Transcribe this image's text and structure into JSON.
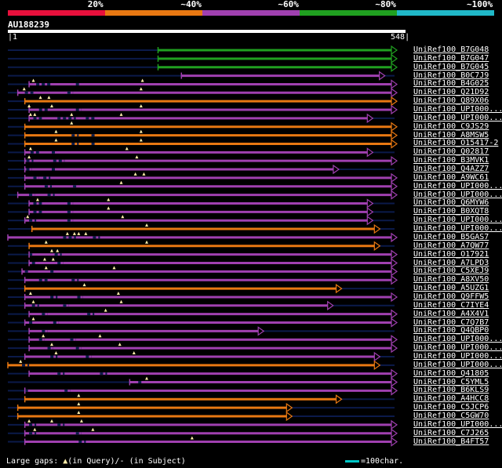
{
  "scale": {
    "labels": [
      "20%",
      "~40%",
      "~60%",
      "~80%",
      "~100%"
    ],
    "colors": [
      "#e8103c",
      "#e87812",
      "#a040b0",
      "#20a020",
      "#20b8c8"
    ]
  },
  "query": {
    "id": "AU188239",
    "start": "1",
    "end": "548",
    "length": 548
  },
  "colors": {
    "background": "#000000",
    "unaligned": "#0b1a4a",
    "purple": "#a040b0",
    "orange": "#e87812",
    "green": "#20a020",
    "gap_marker": "#ffeeaa"
  },
  "hits": [
    {
      "id": "UniRef100_B7G048",
      "start": 212,
      "end": 548,
      "color": "green",
      "gaps": [],
      "tri": []
    },
    {
      "id": "UniRef100_B7G047",
      "start": 212,
      "end": 548,
      "color": "green",
      "gaps": [],
      "tri": []
    },
    {
      "id": "UniRef100_B7G045",
      "start": 212,
      "end": 548,
      "color": "green",
      "gaps": [],
      "tri": []
    },
    {
      "id": "UniRef100_B0C7J9",
      "start": 245,
      "end": 531,
      "color": "purple",
      "gaps": [],
      "tri": []
    },
    {
      "id": "UniRef100_B4G025",
      "start": 30,
      "end": 548,
      "color": "purple",
      "gaps": [
        [
          40,
          62
        ],
        [
          96,
          102
        ]
      ],
      "tri": [
        36,
        190
      ]
    },
    {
      "id": "UniRef100_Q21D92",
      "start": 14,
      "end": 548,
      "color": "purple",
      "gaps": [
        [
          24,
          36
        ],
        [
          84,
          92
        ]
      ],
      "tri": [
        23,
        188
      ]
    },
    {
      "id": "UniRef100_Q89X06",
      "start": 24,
      "end": 548,
      "color": "orange",
      "gaps": [],
      "tri": [
        46,
        58
      ]
    },
    {
      "id": "UniRef100_UPI000...a",
      "start": 30,
      "end": 548,
      "color": "purple",
      "gaps": [
        [
          44,
          58
        ],
        [
          96,
          104
        ]
      ],
      "tri": [
        30,
        62,
        188
      ]
    },
    {
      "id": "UniRef100_UPI000...b",
      "start": 30,
      "end": 514,
      "color": "purple",
      "gaps": [
        [
          36,
          48
        ],
        [
          70,
          96
        ],
        [
          110,
          124
        ]
      ],
      "tri": [
        32,
        38,
        90,
        160
      ]
    },
    {
      "id": "UniRef100_C9JS29",
      "start": 24,
      "end": 548,
      "color": "orange",
      "gaps": [],
      "tri": [
        90
      ]
    },
    {
      "id": "UniRef100_A8MSW5",
      "start": 24,
      "end": 548,
      "color": "orange",
      "gaps": [
        [
          90,
          100
        ],
        [
          118,
          124
        ]
      ],
      "tri": [
        68,
        188
      ]
    },
    {
      "id": "UniRef100_O15417-2",
      "start": 24,
      "end": 548,
      "color": "orange",
      "gaps": [
        [
          90,
          100
        ],
        [
          118,
          124
        ]
      ],
      "tri": [
        68,
        188
      ]
    },
    {
      "id": "UniRef100_Q02817",
      "start": 24,
      "end": 514,
      "color": "purple",
      "gaps": [
        [
          32,
          44
        ],
        [
          62,
          68
        ]
      ],
      "tri": [
        32,
        168
      ]
    },
    {
      "id": "UniRef100_B3MVK1",
      "start": 24,
      "end": 548,
      "color": "purple",
      "gaps": [
        [
          26,
          36
        ],
        [
          64,
          80
        ]
      ],
      "tri": [
        30,
        182
      ]
    },
    {
      "id": "UniRef100_Q4AZZ7",
      "start": 24,
      "end": 466,
      "color": "purple",
      "gaps": [
        [
          26,
          34
        ],
        [
          62,
          68
        ]
      ],
      "tri": []
    },
    {
      "id": "UniRef100_A9WC61",
      "start": 24,
      "end": 548,
      "color": "purple",
      "gaps": [
        [
          36,
          44
        ],
        [
          50,
          60
        ]
      ],
      "tri": [
        180,
        192
      ]
    },
    {
      "id": "UniRef100_UPI000...c",
      "start": 24,
      "end": 548,
      "color": "purple",
      "gaps": [
        [
          52,
          62
        ],
        [
          92,
          98
        ]
      ],
      "tri": [
        160
      ]
    },
    {
      "id": "UniRef100_UPI000...d",
      "start": 14,
      "end": 548,
      "color": "purple",
      "gaps": [
        [
          30,
          38
        ],
        [
          56,
          66
        ]
      ],
      "tri": []
    },
    {
      "id": "UniRef100_Q6MYW6",
      "start": 30,
      "end": 514,
      "color": "purple",
      "gaps": [
        [
          36,
          48
        ],
        [
          84,
          92
        ]
      ],
      "tri": [
        42,
        142
      ]
    },
    {
      "id": "UniRef100_B0XQT8",
      "start": 30,
      "end": 514,
      "color": "purple",
      "gaps": [
        [
          36,
          48
        ],
        [
          84,
          92
        ]
      ],
      "tri": [
        142
      ]
    },
    {
      "id": "UniRef100_UPI000...e",
      "start": 24,
      "end": 514,
      "color": "purple",
      "gaps": [
        [
          30,
          40
        ],
        [
          84,
          92
        ]
      ],
      "tri": [
        28,
        162
      ]
    },
    {
      "id": "UniRef100_UPI000...f",
      "start": 34,
      "end": 524,
      "color": "orange",
      "gaps": [],
      "tri": [
        196
      ]
    },
    {
      "id": "UniRef100_B5GAS7",
      "start": 0,
      "end": 548,
      "color": "purple",
      "gaps": [
        [
          78,
          96
        ],
        [
          120,
          130
        ]
      ],
      "tri": [
        84,
        94,
        100,
        110
      ]
    },
    {
      "id": "UniRef100_A7QW77",
      "start": 30,
      "end": 524,
      "color": "orange",
      "gaps": [],
      "tri": [
        54,
        196
      ]
    },
    {
      "id": "UniRef100_O17921",
      "start": 30,
      "end": 548,
      "color": "purple",
      "gaps": [
        [
          30,
          36
        ],
        [
          66,
          76
        ]
      ],
      "tri": [
        62,
        70
      ]
    },
    {
      "id": "UniRef100_A7LPD3",
      "start": 30,
      "end": 548,
      "color": "purple",
      "gaps": [
        [
          34,
          40
        ],
        [
          70,
          78
        ]
      ],
      "tri": [
        52,
        64
      ]
    },
    {
      "id": "UniRef100_C5XEJ9",
      "start": 20,
      "end": 548,
      "color": "purple",
      "gaps": [
        [
          24,
          30
        ],
        [
          60,
          66
        ]
      ],
      "tri": [
        54,
        150
      ]
    },
    {
      "id": "UniRef100_A8XV50",
      "start": 24,
      "end": 548,
      "color": "purple",
      "gaps": [
        [
          44,
          56
        ],
        [
          90,
          100
        ]
      ],
      "tri": []
    },
    {
      "id": "UniRef100_A5UZG1",
      "start": 24,
      "end": 470,
      "color": "orange",
      "gaps": [],
      "tri": [
        108
      ]
    },
    {
      "id": "UniRef100_Q9FFW5",
      "start": 24,
      "end": 548,
      "color": "purple",
      "gaps": [
        [
          60,
          70
        ],
        [
          98,
          106
        ]
      ],
      "tri": [
        32,
        156
      ]
    },
    {
      "id": "UniRef100_C7IYE4",
      "start": 24,
      "end": 458,
      "color": "purple",
      "gaps": [
        [
          34,
          44
        ],
        [
          78,
          86
        ]
      ],
      "tri": [
        36,
        160
      ]
    },
    {
      "id": "UniRef100_A4X4V1",
      "start": 30,
      "end": 548,
      "color": "purple",
      "gaps": [
        [
          48,
          56
        ],
        [
          112,
          122
        ]
      ],
      "tri": [
        138
      ]
    },
    {
      "id": "UniRef100_C7Q7B7",
      "start": 24,
      "end": 548,
      "color": "purple",
      "gaps": [
        [
          30,
          36
        ],
        [
          64,
          72
        ]
      ],
      "tri": [
        36
      ]
    },
    {
      "id": "UniRef100_Q4QBP0",
      "start": 30,
      "end": 360,
      "color": "purple",
      "gaps": [
        [
          48,
          56
        ]
      ],
      "tri": []
    },
    {
      "id": "UniRef100_UPI000...g",
      "start": 30,
      "end": 548,
      "color": "purple",
      "gaps": [
        [
          44,
          52
        ],
        [
          88,
          96
        ]
      ],
      "tri": [
        50,
        130
      ]
    },
    {
      "id": "UniRef100_UPI000...h",
      "start": 30,
      "end": 548,
      "color": "purple",
      "gaps": [
        [
          56,
          64
        ],
        [
          96,
          104
        ]
      ],
      "tri": [
        62,
        158
      ]
    },
    {
      "id": "UniRef100_UPI000...i",
      "start": 24,
      "end": 524,
      "color": "purple",
      "gaps": [
        [
          60,
          70
        ],
        [
          110,
          118
        ]
      ],
      "tri": [
        68,
        178
      ]
    },
    {
      "id": "UniRef100_UPI000...j",
      "start": 0,
      "end": 524,
      "color": "orange",
      "gaps": [
        [
          20,
          30
        ]
      ],
      "tri": [
        18
      ]
    },
    {
      "id": "UniRef100_Q41805",
      "start": 30,
      "end": 548,
      "color": "purple",
      "gaps": [
        [
          70,
          80
        ],
        [
          130,
          140
        ]
      ],
      "tri": []
    },
    {
      "id": "UniRef100_C5YML5",
      "start": 172,
      "end": 548,
      "color": "purple",
      "gaps": [
        [
          184,
          190
        ]
      ],
      "tri": [
        196
      ]
    },
    {
      "id": "UniRef100_B6KLS9",
      "start": 24,
      "end": 548,
      "color": "purple",
      "gaps": [
        [
          24,
          30
        ],
        [
          80,
          88
        ]
      ],
      "tri": []
    },
    {
      "id": "UniRef100_A4HCC8",
      "start": 24,
      "end": 470,
      "color": "orange",
      "gaps": [],
      "tri": [
        100
      ]
    },
    {
      "id": "UniRef100_C5JCP6",
      "start": 14,
      "end": 400,
      "color": "orange",
      "gaps": [],
      "tri": [
        100
      ]
    },
    {
      "id": "UniRef100_C5GW70",
      "start": 14,
      "end": 400,
      "color": "orange",
      "gaps": [],
      "tri": [
        100
      ]
    },
    {
      "id": "UniRef100_UPI000...k",
      "start": 24,
      "end": 548,
      "color": "purple",
      "gaps": [
        [
          30,
          40
        ],
        [
          70,
          80
        ]
      ],
      "tri": [
        30,
        62,
        104
      ]
    },
    {
      "id": "UniRef100_C7J265",
      "start": 24,
      "end": 548,
      "color": "purple",
      "gaps": [
        [
          30,
          40
        ],
        [
          96,
          104
        ]
      ],
      "tri": [
        38,
        120
      ]
    },
    {
      "id": "UniRef100_B4FT57",
      "start": 24,
      "end": 548,
      "color": "purple",
      "gaps": [
        [
          100,
          110
        ]
      ],
      "tri": [
        260
      ]
    }
  ],
  "hit_display_names": [
    "UniRef100_B7G048",
    "UniRef100_B7G047",
    "UniRef100_B7G045",
    "UniRef100_B0C7J9",
    "UniRef100_B4G025",
    "UniRef100_Q21D92",
    "UniRef100_Q89X06",
    "UniRef100_UPI000...",
    "UniRef100_UPI000...",
    "UniRef100_C9JS29",
    "UniRef100_A8MSW5",
    "UniRef100_O15417-2",
    "UniRef100_Q02817",
    "UniRef100_B3MVK1",
    "UniRef100_Q4AZZ7",
    "UniRef100_A9WC61",
    "UniRef100_UPI000...",
    "UniRef100_UPI000...",
    "UniRef100_Q6MYW6",
    "UniRef100_B0XQT8",
    "UniRef100_UPI000...",
    "UniRef100_UPI000...",
    "UniRef100_B5GAS7",
    "UniRef100_A7QW77",
    "UniRef100_O17921",
    "UniRef100_A7LPD3",
    "UniRef100_C5XEJ9",
    "UniRef100_A8XV50",
    "UniRef100_A5UZG1",
    "UniRef100_Q9FFW5",
    "UniRef100_C7IYE4",
    "UniRef100_A4X4V1",
    "UniRef100_C7Q7B7",
    "UniRef100_Q4QBP0",
    "UniRef100_UPI000...",
    "UniRef100_UPI000...",
    "UniRef100_UPI000...",
    "UniRef100_UPI000...",
    "UniRef100_Q41805",
    "UniRef100_C5YML5",
    "UniRef100_B6KLS9",
    "UniRef100_A4HCC8",
    "UniRef100_C5JCP6",
    "UniRef100_C5GW70",
    "UniRef100_UPI000...",
    "UniRef100_C7J265",
    "UniRef100_B4FT57"
  ],
  "footer": {
    "prefix": "Large gaps: ",
    "tri_glyph": "▲",
    "middle": "(in Query)/",
    "dash": "-",
    "suffix": " (in Subject)"
  },
  "scale_key": {
    "text": "=100char."
  }
}
